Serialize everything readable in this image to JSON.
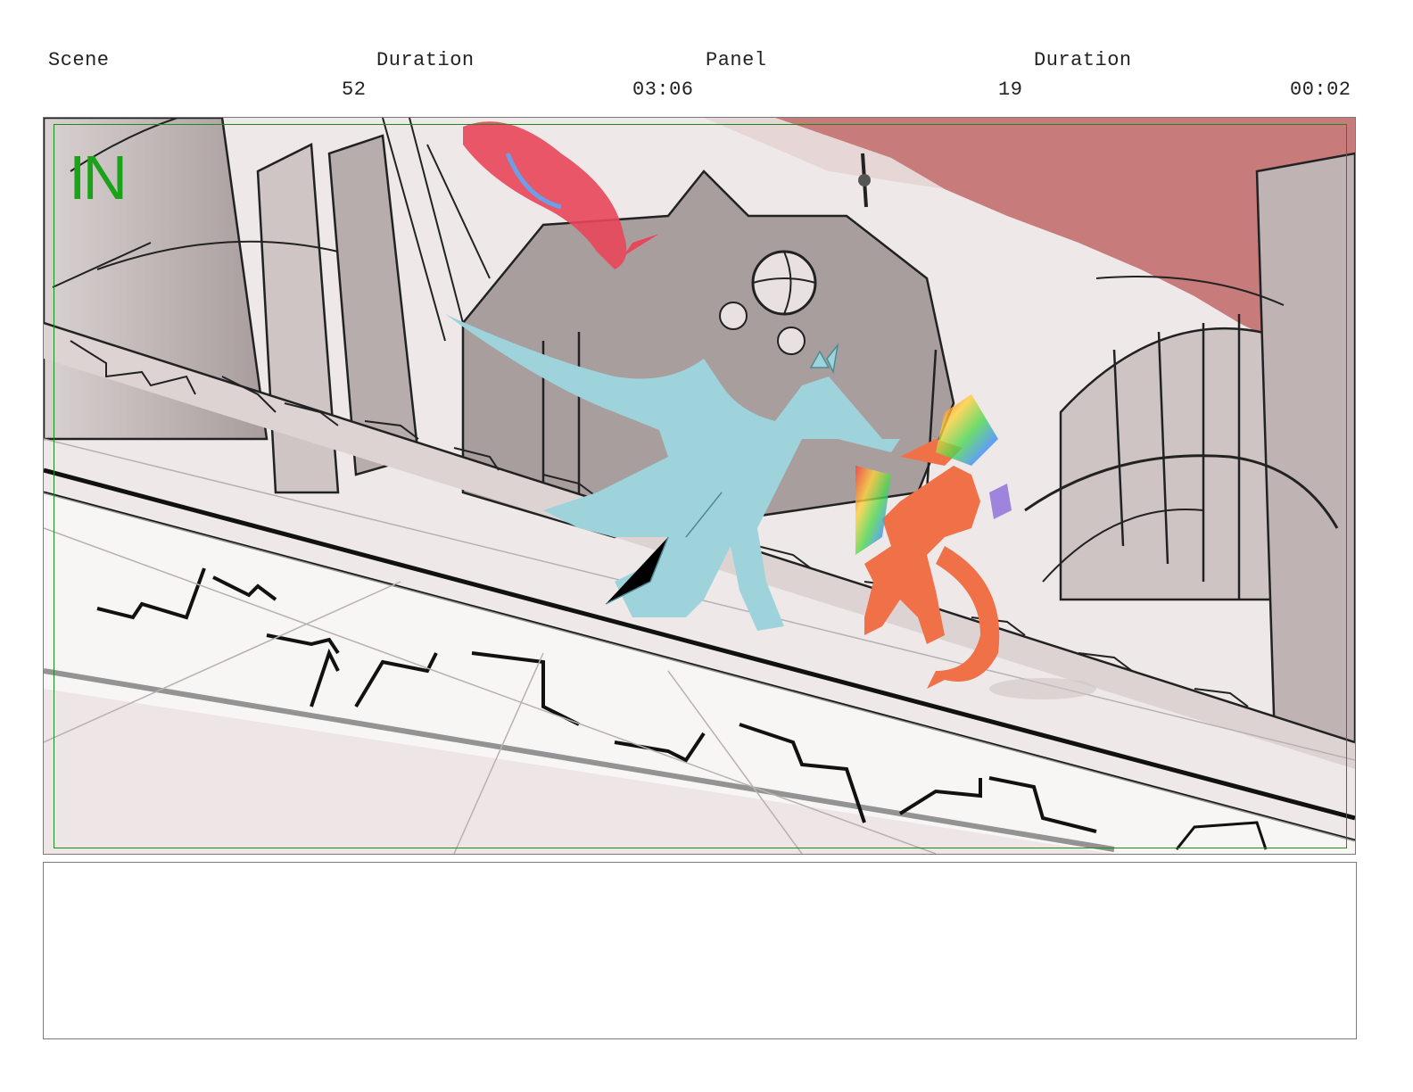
{
  "header": {
    "scene_label": "Scene",
    "scene_value": "52",
    "scene_duration_label": "Duration",
    "scene_duration_value": "03:06",
    "panel_label": "Panel",
    "panel_value": "19",
    "panel_duration_label": "Duration",
    "panel_duration_value": "00:02"
  },
  "panel": {
    "overlay_text": "IN",
    "overlay_color": "#1aa31a",
    "sky_color": "#c77b7b",
    "character_left_color": "#9fd3dc",
    "character_right_color": "#f07048"
  },
  "notes": {
    "text": ""
  }
}
